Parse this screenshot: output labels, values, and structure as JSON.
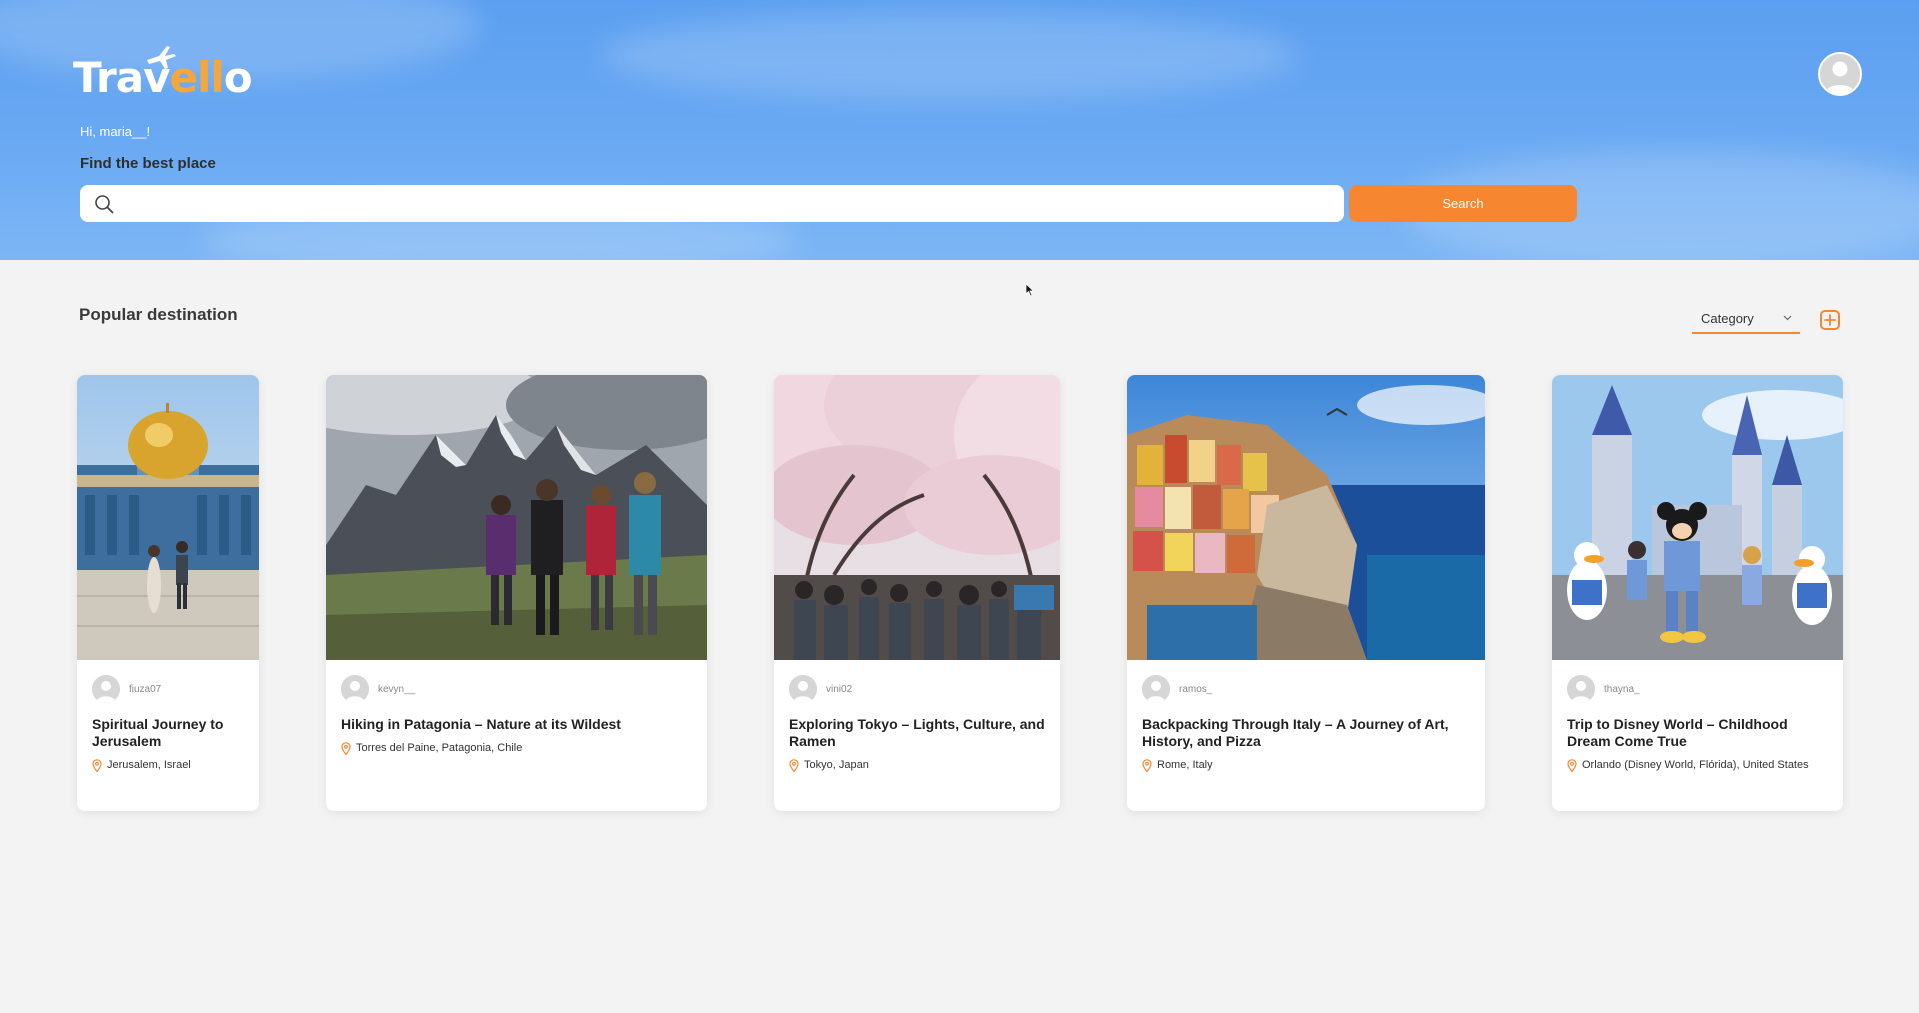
{
  "app": {
    "logo_text_1": "Trav",
    "logo_text_2": "ell",
    "logo_text_3": "o",
    "greeting": "Hi, maria__!",
    "find_label": "Find the best place"
  },
  "search": {
    "placeholder": "",
    "value": "",
    "button_label": "Search"
  },
  "section": {
    "title": "Popular destination",
    "category_label": "Category"
  },
  "colors": {
    "accent": "#f6862f",
    "hero_blue": "#6aa9f3"
  },
  "icons": {
    "search": "search-icon",
    "user": "user-avatar-icon",
    "chevron": "chevron-down-icon",
    "add": "plus-square-icon",
    "location": "location-pin-icon"
  },
  "cards": [
    {
      "author": "fiuza07",
      "title": "Spiritual Journey to Jerusalem",
      "location": "Jerusalem, Israel"
    },
    {
      "author": "kevyn__",
      "title": "Hiking in Patagonia – Nature at its Wildest",
      "location": "Torres del Paine, Patagonia, Chile"
    },
    {
      "author": "vini02",
      "title": "Exploring Tokyo – Lights, Culture, and Ramen",
      "location": "Tokyo, Japan"
    },
    {
      "author": "ramos_",
      "title": "Backpacking Through Italy – A Journey of Art, History, and Pizza",
      "location": "Rome, Italy"
    },
    {
      "author": "thayna_",
      "title": "Trip to Disney World – Childhood Dream Come True",
      "location": "Orlando (Disney World, Flórida), United States"
    }
  ]
}
